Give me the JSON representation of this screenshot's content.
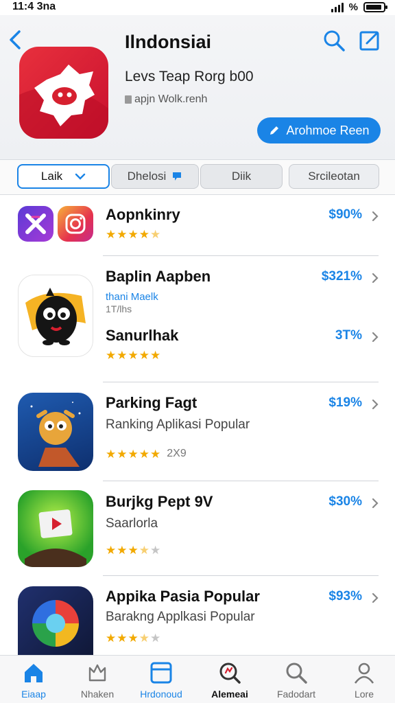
{
  "status_bar": {
    "time": "11:4 3na",
    "battery_text": "%"
  },
  "header": {
    "title": "Ilndonsiai",
    "subtitle": "Levs Teap Rorg b00",
    "developer": "apjn Wolk.renh",
    "install_label": "Arohmoe Reen"
  },
  "filters": [
    {
      "label": "Laik",
      "selected": true
    },
    {
      "label": "Dhelosi",
      "selected": false
    },
    {
      "label": "Diik",
      "selected": false
    },
    {
      "label": "Srcileotan",
      "selected": false
    }
  ],
  "list": {
    "items": [
      {
        "title": "Aopnkinry",
        "price": "$90%",
        "rating": 4.5
      },
      {
        "title": "Baplin Aapben",
        "tag": "thani Maelk",
        "tag2": "1T/lhs",
        "price": "$321%"
      },
      {
        "title": "Sanurlhak",
        "price": "3T%",
        "rating": 5
      },
      {
        "title": "Parking Fagt",
        "subtitle": "Ranking Aplikasi Popular",
        "price": "$19%",
        "rating": 5,
        "rating_count": "2X9"
      },
      {
        "title": "Burjkg Pept 9V",
        "subtitle": "Saarlorla",
        "price": "$30%",
        "rating": 3.5
      },
      {
        "title": "Appika Pasia Popular",
        "subtitle": "Barakng Applkasi Popular",
        "price": "$93%",
        "rating": 3.5
      }
    ]
  },
  "tab_bar": {
    "tabs": [
      {
        "label": "Eiaap",
        "icon": "home-icon",
        "active": true
      },
      {
        "label": "Nhaken",
        "icon": "crown-icon",
        "active": false
      },
      {
        "label": "Hrdonoud",
        "icon": "window-icon",
        "active": false
      },
      {
        "label": "Alemeai",
        "icon": "magnifier-badge-icon",
        "active": false
      },
      {
        "label": "Fadodart",
        "icon": "search-icon",
        "active": false
      },
      {
        "label": "Lore",
        "icon": "person-icon",
        "active": false
      }
    ]
  },
  "colors": {
    "accent": "#1a84e6",
    "star": "#f2a900",
    "brand_red": "#d6202f"
  }
}
